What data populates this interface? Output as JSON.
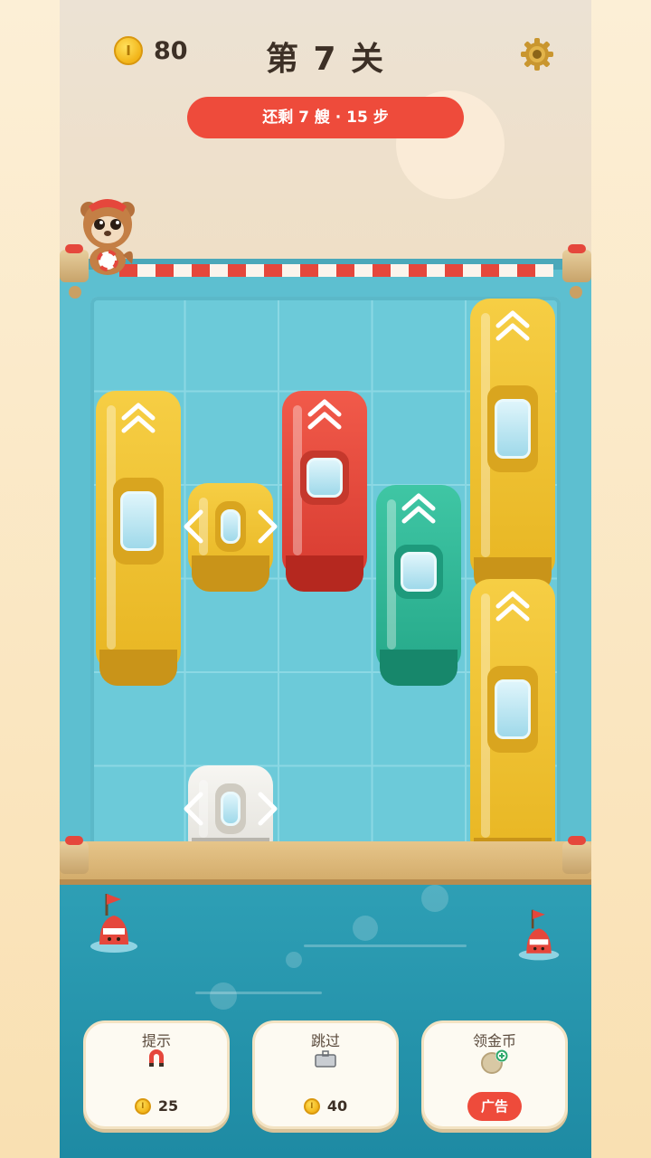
{
  "header": {
    "coins": "80",
    "coin_symbol": "I",
    "level_title": "第 7 关",
    "status": "还剩 7 艘 · 15 步"
  },
  "board": {
    "columns": 5,
    "rows": 6,
    "exit": "top",
    "boats": [
      {
        "id": "boat-yellow-1",
        "color": "#f6ce44",
        "orientation": "vertical",
        "direction": "up"
      },
      {
        "id": "boat-yellow-small",
        "color": "#f6ce44",
        "orientation": "horizontal",
        "direction": "left-right"
      },
      {
        "id": "boat-red",
        "color": "#f15a4a",
        "orientation": "vertical",
        "direction": "up"
      },
      {
        "id": "boat-green",
        "color": "#3fc6a4",
        "orientation": "vertical",
        "direction": "up"
      },
      {
        "id": "boat-yellow-top-right",
        "color": "#f6ce44",
        "orientation": "vertical",
        "direction": "up"
      },
      {
        "id": "boat-yellow-bottom-right",
        "color": "#f6ce44",
        "orientation": "vertical",
        "direction": "up"
      },
      {
        "id": "boat-white",
        "color": "#f7f6f2",
        "orientation": "horizontal",
        "direction": "left-right"
      }
    ]
  },
  "actions": {
    "hint": {
      "label": "提示",
      "icon": "magnet-icon",
      "cost": "25"
    },
    "skip": {
      "label": "跳过",
      "icon": "briefcase-icon",
      "cost": "40"
    },
    "free_coins": {
      "label": "领金币",
      "icon": "coin-plus-icon",
      "badge": "广告"
    }
  },
  "colors": {
    "accent_red": "#ee4b3b",
    "water": "#5dbfd0",
    "text_dark": "#3d3026"
  }
}
